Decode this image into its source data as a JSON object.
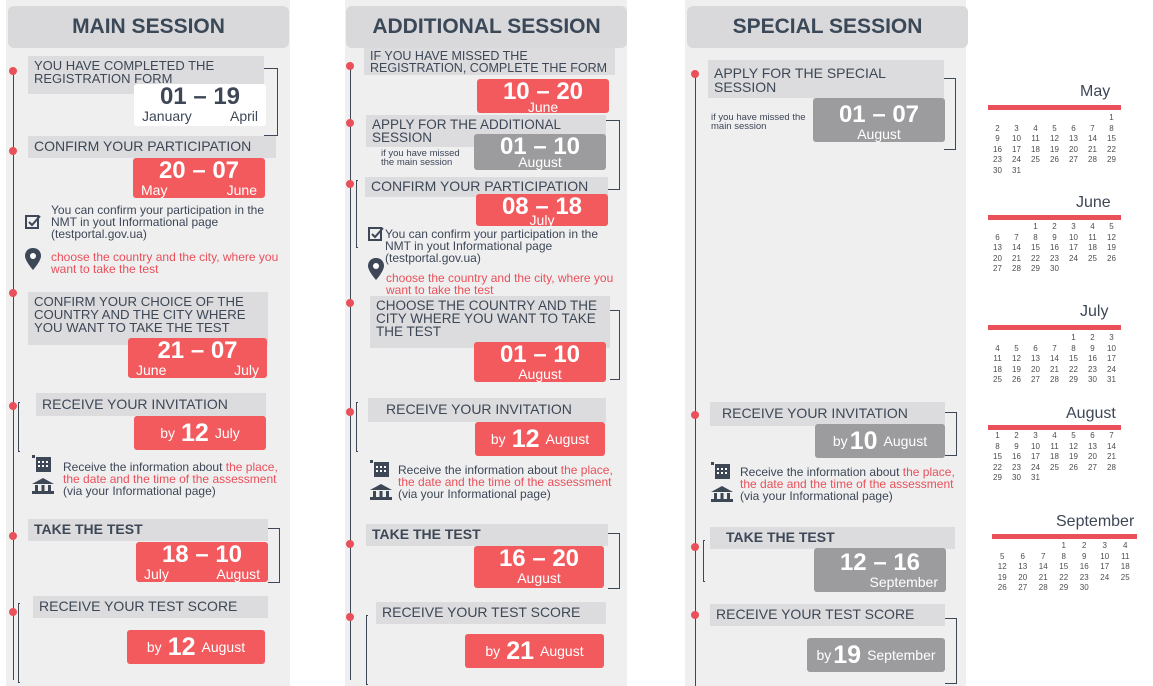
{
  "columns": [
    {
      "title": "MAIN SESSION",
      "steps": [
        {
          "text": "YOU HAVE COMPLETED THE REGISTRATION FORM",
          "date_big": "01 – 19",
          "date_from": "January",
          "date_to": "April"
        },
        {
          "text": "CONFIRM YOUR PARTICIPATION",
          "date_big": "20 – 07",
          "date_from": "May",
          "date_to": "June"
        },
        {
          "text": "CONFIRM YOUR CHOICE OF THE COUNTRY AND THE CITY WHERE YOU WANT TO TAKE THE TEST",
          "date_big": "21 – 07",
          "date_from": "June",
          "date_to": "July"
        },
        {
          "text": "RECEIVE YOUR INVITATION",
          "by": "by",
          "day": "12",
          "month": "July"
        },
        {
          "text": "TAKE THE TEST",
          "date_big": "18 – 10",
          "date_from": "July",
          "date_to": "August"
        },
        {
          "text": "RECEIVE  YOUR TEST SCORE",
          "by": "by",
          "day": "12",
          "month": "August"
        }
      ]
    },
    {
      "title": "ADDITIONAL SESSION",
      "steps": [
        {
          "text": "IF YOU HAVE MISSED THE REGISTRATION, COMPLETE THE FORM",
          "date_big": "10 – 20",
          "date_month": "June"
        },
        {
          "text": "APPLY FOR THE ADDITIONAL SESSION",
          "sub": "if you have missed the main session",
          "date_big": "01 – 10",
          "date_month": "August"
        },
        {
          "text": "CONFIRM YOUR PARTICIPATION",
          "date_big": "08 – 18",
          "date_month": "July"
        },
        {
          "text": "CHOOSE THE COUNTRY AND THE CITY WHERE YOU WANT TO TAKE THE TEST",
          "date_big": "01 – 10",
          "date_month": "August"
        },
        {
          "text": "RECEIVE YOUR INVITATION",
          "by": "by",
          "day": "12",
          "month": "August"
        },
        {
          "text": "TAKE THE TEST",
          "date_big": "16 – 20",
          "date_month": "August"
        },
        {
          "text": "RECEIVE  YOUR TEST SCORE",
          "by": "by",
          "day": "21",
          "month": "August"
        }
      ]
    },
    {
      "title": "SPECIAL SESSION",
      "steps": [
        {
          "text": "APPLY FOR THE SPECIAL SESSION",
          "sub": "if you have missed the main session",
          "date_big": "01 – 07",
          "date_month": "August"
        },
        {
          "text": "RECEIVE YOUR INVITATION",
          "by": "by",
          "day": "10",
          "month": "August"
        },
        {
          "text": "TAKE THE TEST",
          "date_big": "12 – 16",
          "date_month": "September"
        },
        {
          "text": "RECEIVE  YOUR TEST SCORE",
          "by": "by",
          "day": "19",
          "month": "September"
        }
      ]
    }
  ],
  "notes": {
    "confirm": "You can confirm your participation in the NMT in yout Informational page (testportal.gov.ua)",
    "choose": "choose the country and the city, where you want to take the test",
    "info_a": "Receive the information about",
    "info_hl": "the place, the date and the time of the assessment",
    "info_b": "(via your Informational page)"
  },
  "calendars": [
    {
      "month": "May",
      "start": 6,
      "days": 31
    },
    {
      "month": "June",
      "start": 2,
      "days": 30
    },
    {
      "month": "July",
      "start": 4,
      "days": 31
    },
    {
      "month": "August",
      "start": 0,
      "days": 31
    },
    {
      "month": "September",
      "start": 3,
      "days": 30
    }
  ],
  "colors": {
    "accent": "#f25a5e",
    "muted": "#9c9c9e",
    "panel": "#efeff0",
    "text": "#3d4756"
  },
  "icons": [
    "check-square-icon",
    "location-pin-icon",
    "calendar-icon",
    "building-icon",
    "pushpin-icon"
  ]
}
